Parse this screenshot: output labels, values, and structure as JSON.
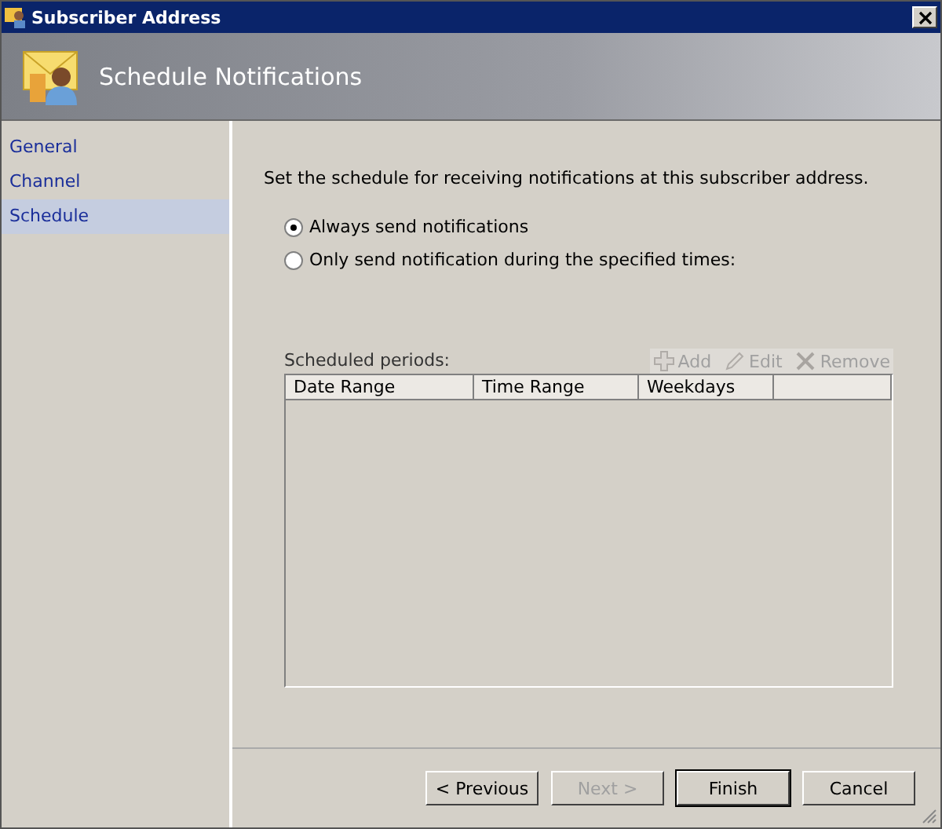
{
  "window": {
    "title": "Subscriber Address"
  },
  "header": {
    "title": "Schedule Notifications"
  },
  "sidebar": {
    "items": [
      {
        "label": "General",
        "selected": false
      },
      {
        "label": "Channel",
        "selected": false
      },
      {
        "label": "Schedule",
        "selected": true
      }
    ]
  },
  "intro": "Set the schedule for receiving notifications at this subscriber address.",
  "options": [
    {
      "label": "Always send notifications",
      "selected": true
    },
    {
      "label": "Only send notification during the specified times:",
      "selected": false
    }
  ],
  "periods": {
    "label": "Scheduled periods:",
    "actions": [
      {
        "kind": "add",
        "label": "Add",
        "disabled": true
      },
      {
        "kind": "edit",
        "label": "Edit",
        "disabled": true
      },
      {
        "kind": "remove",
        "label": "Remove",
        "disabled": true
      }
    ],
    "columns": [
      "Date Range",
      "Time Range",
      "Weekdays"
    ]
  },
  "buttons": [
    {
      "label": "< Previous",
      "disabled": false
    },
    {
      "label": "Next >",
      "disabled": true
    },
    {
      "label": "Finish",
      "disabled": false,
      "default": true
    },
    {
      "label": "Cancel",
      "disabled": false
    }
  ]
}
